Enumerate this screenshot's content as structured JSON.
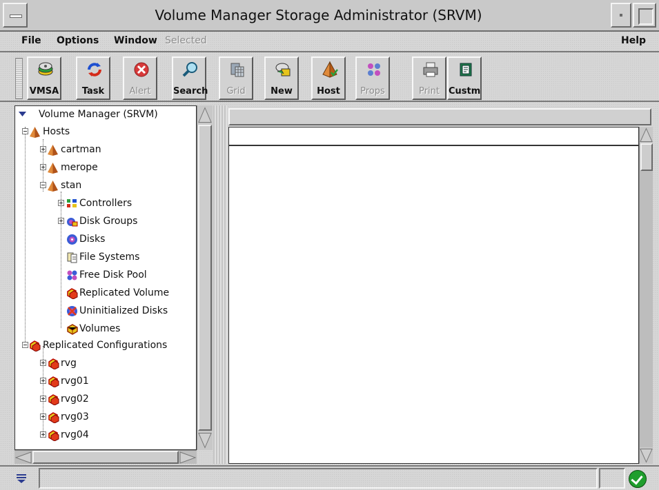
{
  "window": {
    "title": "Volume Manager Storage Administrator (SRVM)"
  },
  "menubar": {
    "items": [
      {
        "label": "File",
        "enabled": true
      },
      {
        "label": "Options",
        "enabled": true
      },
      {
        "label": "Window",
        "enabled": true
      },
      {
        "label": "Selected",
        "enabled": false
      },
      {
        "label": "Help",
        "enabled": true
      }
    ]
  },
  "toolbar": {
    "buttons": [
      {
        "label": "VMSA",
        "icon": "disk-stack-icon",
        "enabled": true
      },
      {
        "label": "Task",
        "icon": "refresh-arrows-icon",
        "enabled": true
      },
      {
        "label": "Alert",
        "icon": "alert-x-icon",
        "enabled": false
      },
      {
        "label": "Search",
        "icon": "magnifier-icon",
        "enabled": true
      },
      {
        "label": "Grid",
        "icon": "grid-icon",
        "enabled": false
      },
      {
        "label": "New",
        "icon": "new-volume-icon",
        "enabled": true
      },
      {
        "label": "Host",
        "icon": "pyramid-host-icon",
        "enabled": true
      },
      {
        "label": "Props",
        "icon": "properties-icon",
        "enabled": false
      },
      {
        "label": "Print",
        "icon": "printer-icon",
        "enabled": false
      },
      {
        "label": "Custm",
        "icon": "customize-icon",
        "enabled": true
      }
    ]
  },
  "tree": {
    "root": "Volume Manager (SRVM)",
    "hosts_label": "Hosts",
    "hosts": [
      "cartman",
      "merope",
      "stan"
    ],
    "stan_children": [
      "Controllers",
      "Disk Groups",
      "Disks",
      "File Systems",
      "Free Disk Pool",
      "Replicated Volume",
      "Uninitialized Disks",
      "Volumes"
    ],
    "replicated_label": "Replicated Configurations",
    "rvgs": [
      "rvg",
      "rvg01",
      "rvg02",
      "rvg03",
      "rvg04"
    ]
  },
  "colors": {
    "accent": "#cc3b12",
    "pyramid": "#c2661f",
    "status_ok": "#1f9e2d"
  }
}
